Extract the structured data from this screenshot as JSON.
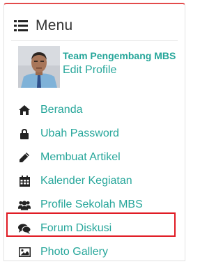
{
  "menu": {
    "title": "Menu",
    "icon": "list-icon"
  },
  "profile": {
    "name": "Team Pengembang MBS",
    "edit_label": "Edit Profile"
  },
  "nav": {
    "items": [
      {
        "label": "Beranda",
        "icon": "home-icon"
      },
      {
        "label": "Ubah Password",
        "icon": "lock-icon"
      },
      {
        "label": "Membuat Artikel",
        "icon": "pencil-icon"
      },
      {
        "label": "Kalender Kegiatan",
        "icon": "calendar-icon"
      },
      {
        "label": "Profile Sekolah MBS",
        "icon": "users-icon"
      },
      {
        "label": "Forum Diskusi",
        "icon": "comments-icon"
      },
      {
        "label": "Photo Gallery",
        "icon": "image-icon"
      }
    ],
    "highlighted_item": "Forum Diskusi"
  },
  "colors": {
    "accent_top_border": "#e34b4b",
    "link": "#26a69a",
    "highlight_box": "#e01b24",
    "icon": "#222222"
  }
}
